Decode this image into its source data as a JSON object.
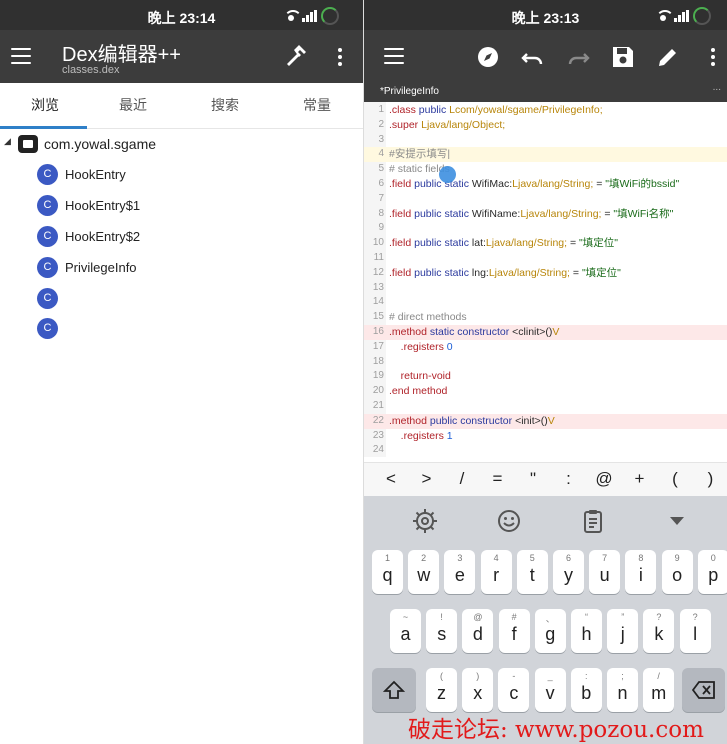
{
  "status_left": {
    "time": "晚上 23:14"
  },
  "status_right": {
    "time": "晚上 23:13"
  },
  "left_app": {
    "title": "Dex编辑器++",
    "subtitle": "classes.dex",
    "tabs": [
      "浏览",
      "最近",
      "搜索",
      "常量"
    ],
    "package": "com.yowal.sgame",
    "class_badge": "C",
    "classes": [
      "HookEntry",
      "HookEntry$1",
      "HookEntry$2",
      "PrivilegeInfo",
      "",
      ""
    ]
  },
  "right_app": {
    "file_tab": "*PrivilegeInfo",
    "file_tab_more": "...",
    "code_lines": [
      {
        "n": "1",
        "hl": "",
        "tokens": [
          [
            "dir",
            ".class "
          ],
          [
            "kw",
            "public "
          ],
          [
            "ty",
            "Lcom/yowal/sgame/PrivilegeInfo;"
          ]
        ]
      },
      {
        "n": "2",
        "hl": "",
        "tokens": [
          [
            "dir",
            ".super "
          ],
          [
            "ty",
            "Ljava/lang/Object;"
          ]
        ]
      },
      {
        "n": "3",
        "hl": "",
        "tokens": []
      },
      {
        "n": "4",
        "hl": "yellow",
        "tokens": [
          [
            "cm",
            "#安提示填写|"
          ]
        ]
      },
      {
        "n": "5",
        "hl": "",
        "tokens": [
          [
            "cm",
            "# static fields"
          ]
        ]
      },
      {
        "n": "6",
        "hl": "",
        "tokens": [
          [
            "dir",
            ".field "
          ],
          [
            "kw",
            "public static "
          ],
          [
            "pl",
            "WifiMac:"
          ],
          [
            "ty",
            "Ljava/lang/String;"
          ],
          [
            "pl",
            " = "
          ],
          [
            "st",
            "\"填WiFi的bssid\""
          ]
        ]
      },
      {
        "n": "7",
        "hl": "",
        "tokens": []
      },
      {
        "n": "8",
        "hl": "",
        "tokens": [
          [
            "dir",
            ".field "
          ],
          [
            "kw",
            "public static "
          ],
          [
            "pl",
            "WifiName:"
          ],
          [
            "ty",
            "Ljava/lang/String;"
          ],
          [
            "pl",
            " = "
          ],
          [
            "st",
            "\"填WiFi名称\""
          ]
        ]
      },
      {
        "n": "9",
        "hl": "",
        "tokens": []
      },
      {
        "n": "10",
        "hl": "",
        "tokens": [
          [
            "dir",
            ".field "
          ],
          [
            "kw",
            "public static "
          ],
          [
            "pl",
            "lat:"
          ],
          [
            "ty",
            "Ljava/lang/String;"
          ],
          [
            "pl",
            " = "
          ],
          [
            "st",
            "\"填定位\""
          ]
        ]
      },
      {
        "n": "11",
        "hl": "",
        "tokens": []
      },
      {
        "n": "12",
        "hl": "",
        "tokens": [
          [
            "dir",
            ".field "
          ],
          [
            "kw",
            "public static "
          ],
          [
            "pl",
            "lng:"
          ],
          [
            "ty",
            "Ljava/lang/String;"
          ],
          [
            "pl",
            " = "
          ],
          [
            "st",
            "\"填定位\""
          ]
        ]
      },
      {
        "n": "13",
        "hl": "",
        "tokens": []
      },
      {
        "n": "14",
        "hl": "",
        "tokens": []
      },
      {
        "n": "15",
        "hl": "",
        "tokens": [
          [
            "cm",
            "# direct methods"
          ]
        ]
      },
      {
        "n": "16",
        "hl": "red",
        "tokens": [
          [
            "dir",
            ".method "
          ],
          [
            "kw",
            "static constructor "
          ],
          [
            "pl",
            "<clinit>()"
          ],
          [
            "ty",
            "V"
          ]
        ]
      },
      {
        "n": "17",
        "hl": "",
        "tokens": [
          [
            "pl",
            "    "
          ],
          [
            "dir",
            ".registers "
          ],
          [
            "num",
            "0"
          ]
        ]
      },
      {
        "n": "18",
        "hl": "",
        "tokens": []
      },
      {
        "n": "19",
        "hl": "",
        "tokens": [
          [
            "pl",
            "    "
          ],
          [
            "dir",
            "return-void"
          ]
        ]
      },
      {
        "n": "20",
        "hl": "",
        "tokens": [
          [
            "dir",
            ".end method"
          ]
        ]
      },
      {
        "n": "21",
        "hl": "",
        "tokens": []
      },
      {
        "n": "22",
        "hl": "red",
        "tokens": [
          [
            "dir",
            ".method "
          ],
          [
            "kw",
            "public constructor "
          ],
          [
            "pl",
            "<init>()"
          ],
          [
            "ty",
            "V"
          ]
        ]
      },
      {
        "n": "23",
        "hl": "",
        "tokens": [
          [
            "pl",
            "    "
          ],
          [
            "dir",
            ".registers "
          ],
          [
            "num",
            "1"
          ]
        ]
      },
      {
        "n": "24",
        "hl": "",
        "tokens": []
      }
    ],
    "symbols": [
      "<",
      ">",
      "/",
      "=",
      "\"",
      ":",
      "@",
      "+",
      "(",
      ")"
    ],
    "keyboard": {
      "row1": [
        [
          "1",
          "q"
        ],
        [
          "2",
          "w"
        ],
        [
          "3",
          "e"
        ],
        [
          "4",
          "r"
        ],
        [
          "5",
          "t"
        ],
        [
          "6",
          "y"
        ],
        [
          "7",
          "u"
        ],
        [
          "8",
          "i"
        ],
        [
          "9",
          "o"
        ],
        [
          "0",
          "p"
        ]
      ],
      "row2": [
        [
          "~",
          "a"
        ],
        [
          "!",
          "s"
        ],
        [
          "@",
          "d"
        ],
        [
          "#",
          "f"
        ],
        [
          "、",
          "g"
        ],
        [
          "“",
          "h"
        ],
        [
          "”",
          "j"
        ],
        [
          "?",
          "k"
        ],
        [
          "?",
          "l"
        ]
      ],
      "row3": [
        [
          "(",
          "z"
        ],
        [
          ")",
          "x"
        ],
        [
          "-",
          "c"
        ],
        [
          "_",
          "v"
        ],
        [
          ":",
          "b"
        ],
        [
          ";",
          "n"
        ],
        [
          "/",
          "m"
        ]
      ]
    }
  },
  "watermark": "破走论坛: www.pozou.com"
}
